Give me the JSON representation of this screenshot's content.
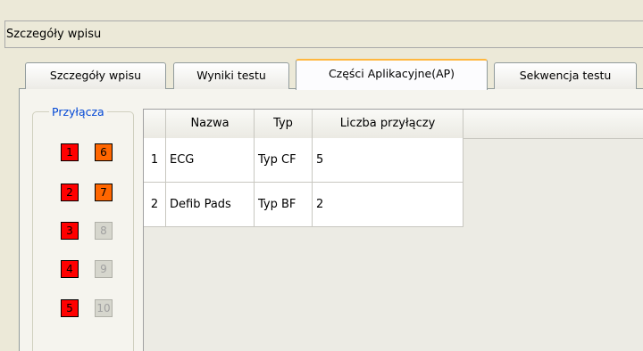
{
  "section_header": "Szczegóły wpisu",
  "tabs": [
    {
      "label": "Szczegóły wpisu",
      "active": false
    },
    {
      "label": "Wyniki testu",
      "active": false
    },
    {
      "label": "Części Aplikacyjne(AP)",
      "active": true
    },
    {
      "label": "Sekwencja testu",
      "active": false
    }
  ],
  "connectors": {
    "title": "Przyłącza",
    "ports": [
      {
        "label": "1",
        "state": "red"
      },
      {
        "label": "6",
        "state": "orange"
      },
      {
        "label": "2",
        "state": "red"
      },
      {
        "label": "7",
        "state": "orange"
      },
      {
        "label": "3",
        "state": "red"
      },
      {
        "label": "8",
        "state": "gray"
      },
      {
        "label": "4",
        "state": "red"
      },
      {
        "label": "9",
        "state": "gray"
      },
      {
        "label": "5",
        "state": "red"
      },
      {
        "label": "10",
        "state": "gray"
      }
    ],
    "colors": {
      "red": "#ff0000",
      "orange": "#ff6600",
      "gray": "#d6d6cd"
    }
  },
  "table": {
    "columns": [
      "Nazwa",
      "Typ",
      "Liczba przyłączy"
    ],
    "rows": [
      {
        "index": "1",
        "cells": [
          "ECG",
          "Typ CF",
          "5"
        ]
      },
      {
        "index": "2",
        "cells": [
          "Defib Pads",
          "Typ BF",
          "2"
        ]
      }
    ]
  }
}
